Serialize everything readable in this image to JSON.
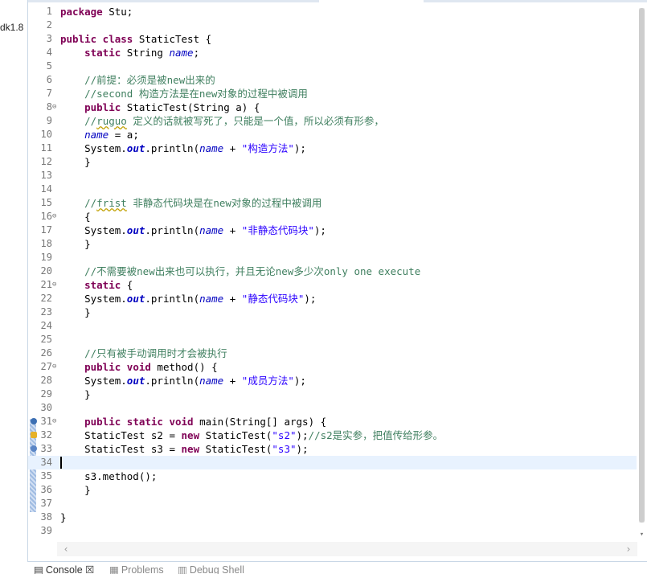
{
  "sidebar": {
    "tree_text": "dk1.8"
  },
  "editor": {
    "lines": [
      {
        "n": "1",
        "fold": "",
        "marker": "",
        "html": "<span class=\"kw\">package</span> Stu;"
      },
      {
        "n": "2",
        "fold": "",
        "marker": "",
        "html": ""
      },
      {
        "n": "3",
        "fold": "",
        "marker": "",
        "html": "<span class=\"kw\">public class</span> StaticTest {"
      },
      {
        "n": "4",
        "fold": "",
        "marker": "",
        "html": "    <span class=\"kw\">static</span> String <span class=\"fld\">name</span>;"
      },
      {
        "n": "5",
        "fold": "",
        "marker": "",
        "html": ""
      },
      {
        "n": "6",
        "fold": "",
        "marker": "",
        "html": "    <span class=\"cm\">//前提：必须是被new出来的</span>"
      },
      {
        "n": "7",
        "fold": "",
        "marker": "",
        "html": "    <span class=\"cm\">//second 构造方法是在new对象的过程中被调用</span>"
      },
      {
        "n": "8",
        "fold": "⊖",
        "marker": "",
        "html": "    <span class=\"kw\">public</span> StaticTest(String a) {"
      },
      {
        "n": "9",
        "fold": "",
        "marker": "",
        "html": "    <span class=\"cm\">//<span class=\"sq\">ruguo</span> 定义的话就被写死了，只能是一个值，所以必须有形参，</span>"
      },
      {
        "n": "10",
        "fold": "",
        "marker": "",
        "html": "    <span class=\"fld\">name</span> = a;"
      },
      {
        "n": "11",
        "fold": "",
        "marker": "",
        "html": "    System.<span class=\"sfld\">out</span>.println(<span class=\"fld\">name</span> + <span class=\"str\">\"构造方法\"</span>);"
      },
      {
        "n": "12",
        "fold": "",
        "marker": "",
        "html": "    }"
      },
      {
        "n": "13",
        "fold": "",
        "marker": "",
        "html": ""
      },
      {
        "n": "14",
        "fold": "",
        "marker": "",
        "html": ""
      },
      {
        "n": "15",
        "fold": "",
        "marker": "",
        "html": "    <span class=\"cm\">//<span class=\"sq\">frist</span> 非静态代码块是在new对象的过程中被调用</span>"
      },
      {
        "n": "16",
        "fold": "⊖",
        "marker": "",
        "html": "    {"
      },
      {
        "n": "17",
        "fold": "",
        "marker": "",
        "html": "    System.<span class=\"sfld\">out</span>.println(<span class=\"fld\">name</span> + <span class=\"str\">\"非静态代码块\"</span>);"
      },
      {
        "n": "18",
        "fold": "",
        "marker": "",
        "html": "    }"
      },
      {
        "n": "19",
        "fold": "",
        "marker": "",
        "html": ""
      },
      {
        "n": "20",
        "fold": "",
        "marker": "",
        "html": "    <span class=\"cm\">//不需要被new出来也可以执行，并且无论new多少次only one execute</span>"
      },
      {
        "n": "21",
        "fold": "⊖",
        "marker": "",
        "html": "    <span class=\"kw\">static</span> {"
      },
      {
        "n": "22",
        "fold": "",
        "marker": "",
        "html": "    System.<span class=\"sfld\">out</span>.println(<span class=\"fld\">name</span> + <span class=\"str\">\"静态代码块\"</span>);"
      },
      {
        "n": "23",
        "fold": "",
        "marker": "",
        "html": "    }"
      },
      {
        "n": "24",
        "fold": "",
        "marker": "",
        "html": ""
      },
      {
        "n": "25",
        "fold": "",
        "marker": "",
        "html": ""
      },
      {
        "n": "26",
        "fold": "",
        "marker": "",
        "html": "    <span class=\"cm\">//只有被手动调用时才会被执行</span>"
      },
      {
        "n": "27",
        "fold": "⊖",
        "marker": "",
        "html": "    <span class=\"kw\">public void</span> method() {"
      },
      {
        "n": "28",
        "fold": "",
        "marker": "",
        "html": "    System.<span class=\"sfld\">out</span>.println(<span class=\"fld\">name</span> + <span class=\"str\">\"成员方法\"</span>);"
      },
      {
        "n": "29",
        "fold": "",
        "marker": "",
        "html": "    }"
      },
      {
        "n": "30",
        "fold": "",
        "marker": "",
        "html": ""
      },
      {
        "n": "31",
        "fold": "⊖",
        "marker": "override",
        "html": "    <span class=\"kw\">public static void</span> main(String[] args) {"
      },
      {
        "n": "32",
        "fold": "",
        "marker": "warn",
        "html": "    StaticTest s2 = <span class=\"kw\">new</span> StaticTest(<span class=\"str\">\"s2\"</span>);<span class=\"cm\">//s2是实参，把值传给形参。</span>"
      },
      {
        "n": "33",
        "fold": "",
        "marker": "blue",
        "html": "    StaticTest s3 = <span class=\"kw\">new</span> StaticTest(<span class=\"str\">\"s3\"</span>);"
      },
      {
        "n": "34",
        "fold": "",
        "marker": "",
        "html": "",
        "current": true
      },
      {
        "n": "35",
        "fold": "",
        "marker": "",
        "html": "    s3.method();"
      },
      {
        "n": "36",
        "fold": "",
        "marker": "",
        "html": "    }"
      },
      {
        "n": "37",
        "fold": "",
        "marker": "",
        "html": ""
      },
      {
        "n": "38",
        "fold": "",
        "marker": "",
        "html": "}"
      },
      {
        "n": "39",
        "fold": "",
        "marker": "",
        "html": ""
      }
    ]
  },
  "bottom_tabs": [
    {
      "label": "Console",
      "suffix": " ☒",
      "icon": "▤",
      "dim": false
    },
    {
      "label": "Problems",
      "suffix": "",
      "icon": "▦",
      "dim": true
    },
    {
      "label": "Debug Shell",
      "suffix": "",
      "icon": "▥",
      "dim": true
    }
  ],
  "colors": {
    "keyword": "#7f0055",
    "comment": "#3f7f5f",
    "string": "#2a00ff",
    "field": "#0000c0",
    "current_line": "#e8f2fe"
  }
}
